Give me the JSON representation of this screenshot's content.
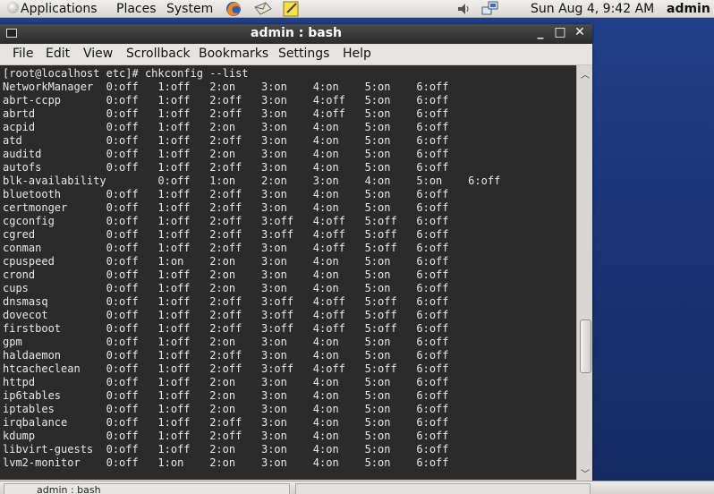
{
  "top_panel": {
    "menus": [
      "Applications",
      "Places",
      "System"
    ],
    "clock": "Sun Aug  4,  9:42 AM",
    "user": "admin",
    "icons": [
      "firefox-icon",
      "mail-icon",
      "notes-icon",
      "volume-icon",
      "network-icon"
    ]
  },
  "window": {
    "title": "admin : bash",
    "controls": [
      "minimize",
      "maximize",
      "close"
    ],
    "menu": [
      "File",
      "Edit",
      "View",
      "Scrollback",
      "Bookmarks",
      "Settings",
      "Help"
    ]
  },
  "terminal": {
    "prompt_line": "[root@localhost etc]# chkconfig --list",
    "rows": [
      "NetworkManager  0:off   1:off   2:on    3:on    4:on    5:on    6:off",
      "abrt-ccpp       0:off   1:off   2:off   3:on    4:off   5:on    6:off",
      "abrtd           0:off   1:off   2:off   3:on    4:off   5:on    6:off",
      "acpid           0:off   1:off   2:on    3:on    4:on    5:on    6:off",
      "atd             0:off   1:off   2:off   3:on    4:on    5:on    6:off",
      "auditd          0:off   1:off   2:on    3:on    4:on    5:on    6:off",
      "autofs          0:off   1:off   2:off   3:on    4:on    5:on    6:off",
      "blk-availability        0:off   1:on    2:on    3:on    4:on    5:on    6:off",
      "bluetooth       0:off   1:off   2:off   3:on    4:on    5:on    6:off",
      "certmonger      0:off   1:off   2:off   3:on    4:on    5:on    6:off",
      "cgconfig        0:off   1:off   2:off   3:off   4:off   5:off   6:off",
      "cgred           0:off   1:off   2:off   3:off   4:off   5:off   6:off",
      "conman          0:off   1:off   2:off   3:on    4:off   5:off   6:off",
      "cpuspeed        0:off   1:on    2:on    3:on    4:on    5:on    6:off",
      "crond           0:off   1:off   2:on    3:on    4:on    5:on    6:off",
      "cups            0:off   1:off   2:on    3:on    4:on    5:on    6:off",
      "dnsmasq         0:off   1:off   2:off   3:off   4:off   5:off   6:off",
      "dovecot         0:off   1:off   2:off   3:off   4:off   5:off   6:off",
      "firstboot       0:off   1:off   2:off   3:off   4:off   5:off   6:off",
      "gpm             0:off   1:off   2:on    3:on    4:on    5:on    6:off",
      "haldaemon       0:off   1:off   2:off   3:on    4:on    5:on    6:off",
      "htcacheclean    0:off   1:off   2:off   3:off   4:off   5:off   6:off",
      "httpd           0:off   1:off   2:on    3:on    4:on    5:on    6:off",
      "ip6tables       0:off   1:off   2:on    3:on    4:on    5:on    6:off",
      "iptables        0:off   1:off   2:on    3:on    4:on    5:on    6:off",
      "irqbalance      0:off   1:off   2:off   3:on    4:on    5:on    6:off",
      "kdump           0:off   1:off   2:off   3:on    4:on    5:on    6:off",
      "libvirt-guests  0:off   1:off   2:on    3:on    4:on    5:on    6:off",
      "lvm2-monitor    0:off   1:on    2:on    3:on    4:on    5:on    6:off"
    ]
  },
  "taskbar": {
    "item_label": "admin : bash"
  }
}
